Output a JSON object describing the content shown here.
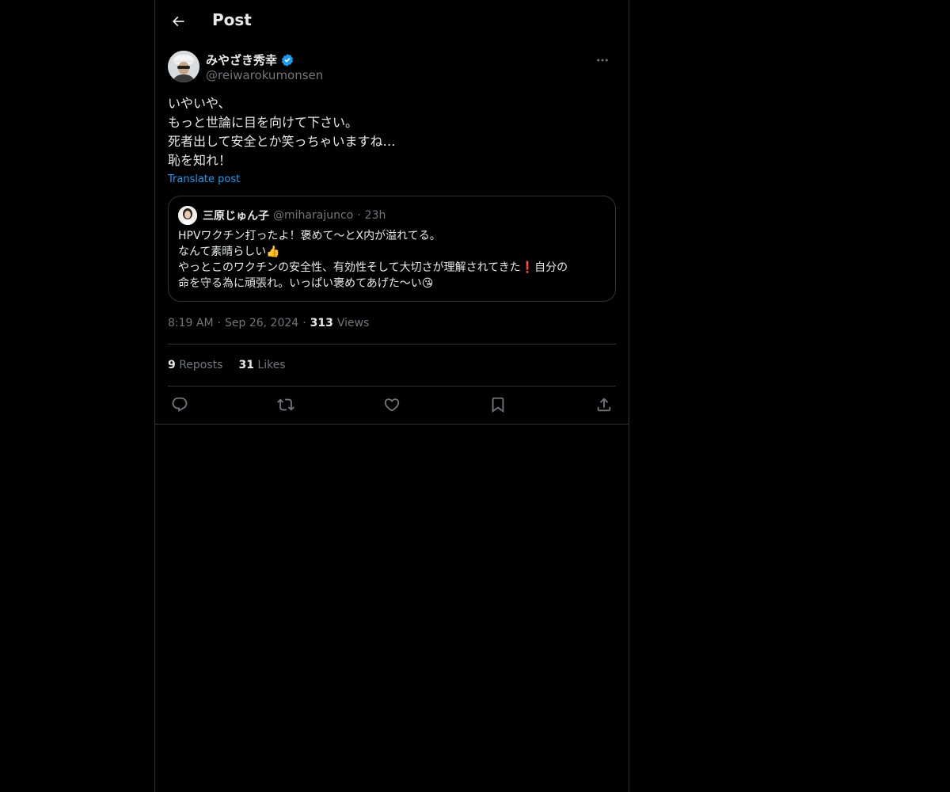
{
  "header": {
    "title": "Post"
  },
  "post": {
    "author": {
      "display_name": "みやざき秀幸",
      "handle": "@reiwarokumonsen",
      "verified": true
    },
    "text_lines": [
      "いやいや、",
      "もっと世論に目を向けて下さい。",
      "死者出して安全とか笑っちゃいますね…",
      "恥を知れ！"
    ],
    "translate_label": "Translate post",
    "time": "8:19 AM",
    "date": "Sep 26, 2024",
    "views_count": "313",
    "views_label": "Views",
    "separator": "·"
  },
  "quote": {
    "display_name": "三原じゅん子",
    "handle": "@miharajunco",
    "separator": "·",
    "time": "23h",
    "text_lines": [
      "HPVワクチン打ったよ！褒めて〜とX内が溢れてる。",
      "なんて素晴らしい👍",
      "やっとこのワクチンの安全性、有効性そして大切さが理解されてきた❗️自分の",
      "命を守る為に頑張れ。いっぱい褒めてあげた〜い😘"
    ]
  },
  "stats": {
    "reposts_count": "9",
    "reposts_label": "Reposts",
    "likes_count": "31",
    "likes_label": "Likes"
  },
  "icons": {
    "back": "arrow-left-icon",
    "verified": "verified-badge-icon",
    "more": "more-horizontal-icon",
    "reply": "reply-icon",
    "repost": "repost-icon",
    "like": "heart-icon",
    "bookmark": "bookmark-icon",
    "share": "share-icon"
  },
  "colors": {
    "background": "#000000",
    "text_primary": "#e7e9ea",
    "text_secondary": "#71767b",
    "link": "#1d9bf0",
    "border": "#2f3336",
    "verified": "#1d9bf0"
  }
}
